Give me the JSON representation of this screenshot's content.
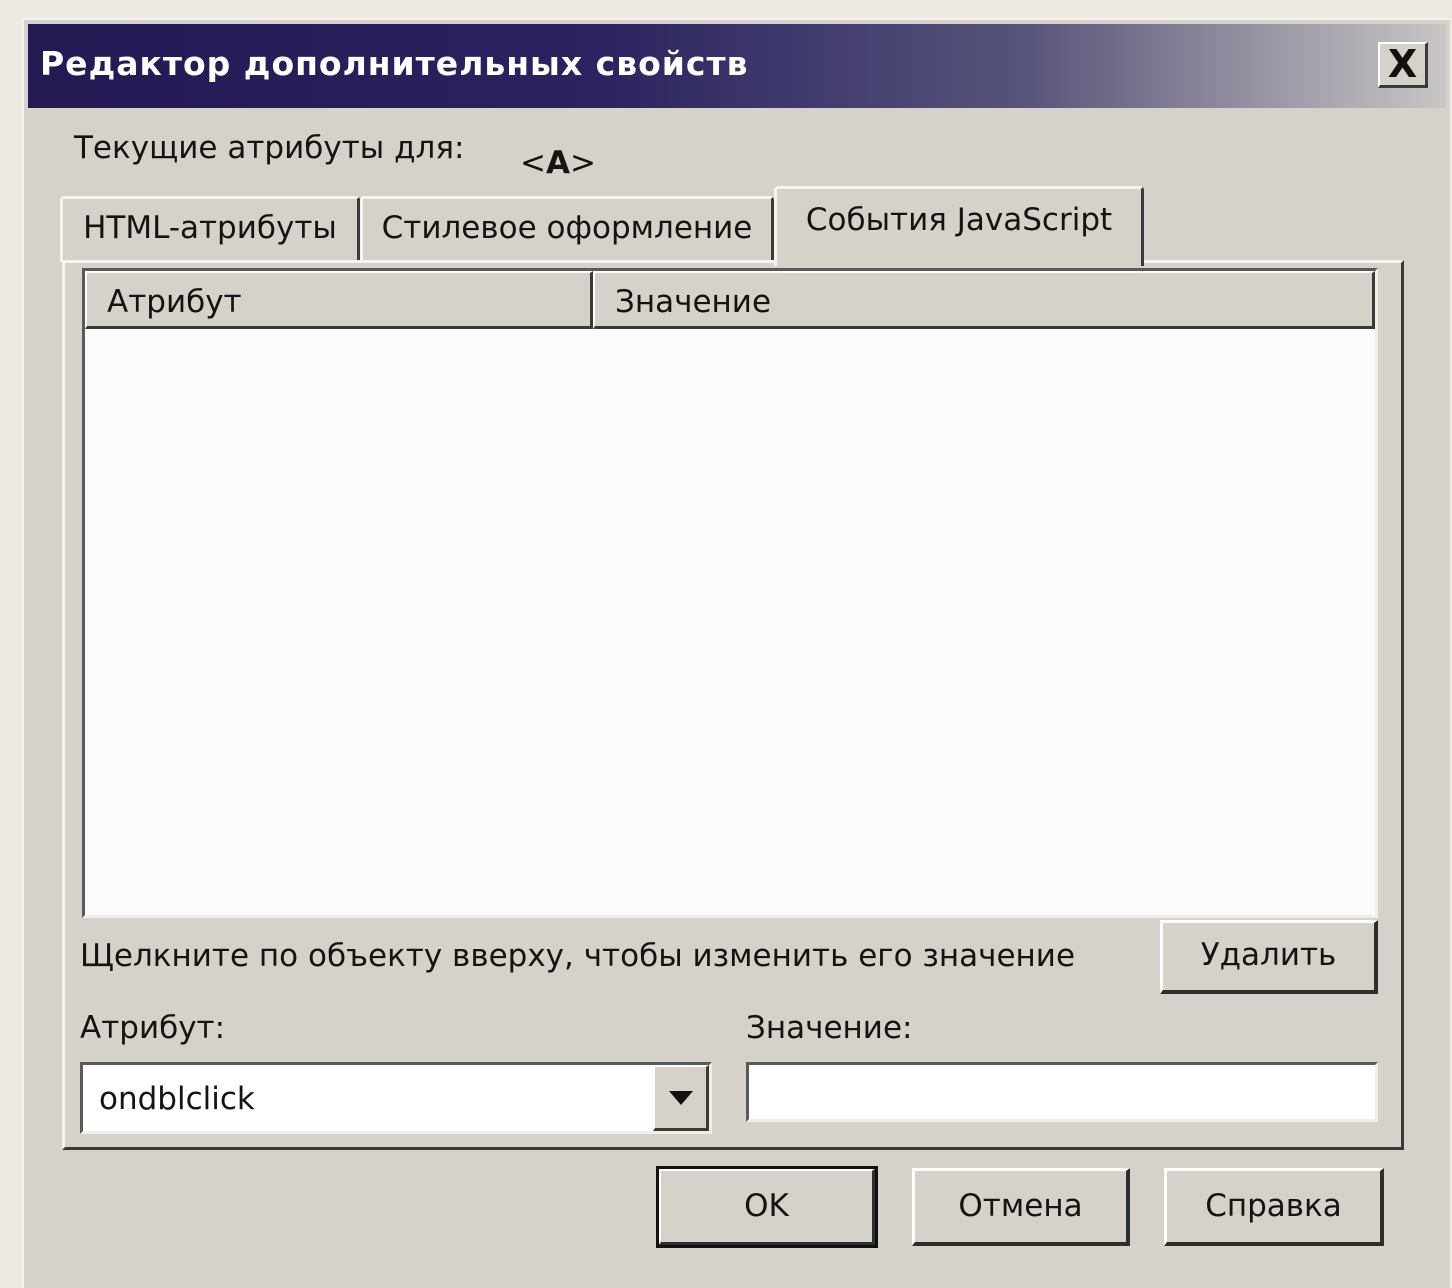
{
  "window": {
    "title": "Редактор дополнительных свойств",
    "close_glyph": "X"
  },
  "current_attributes": {
    "label": "Текущие атрибуты для:",
    "tag_open": "<",
    "tag_name": "A",
    "tag_close": ">"
  },
  "tabs": [
    {
      "label": "HTML-атрибуты",
      "active": false
    },
    {
      "label": "Стилевое оформление",
      "active": false
    },
    {
      "label": "События JavaScript",
      "active": true
    }
  ],
  "table": {
    "columns": [
      "Атрибут",
      "Значение"
    ],
    "rows": []
  },
  "hint_text": "Щелкните по объекту вверху, чтобы изменить его значение",
  "delete_button": "Удалить",
  "attribute_field": {
    "label": "Атрибут:",
    "value": "ondblclick"
  },
  "value_field": {
    "label": "Значение:",
    "value": ""
  },
  "buttons": {
    "ok": "OK",
    "cancel": "Отмена",
    "help": "Справка"
  }
}
